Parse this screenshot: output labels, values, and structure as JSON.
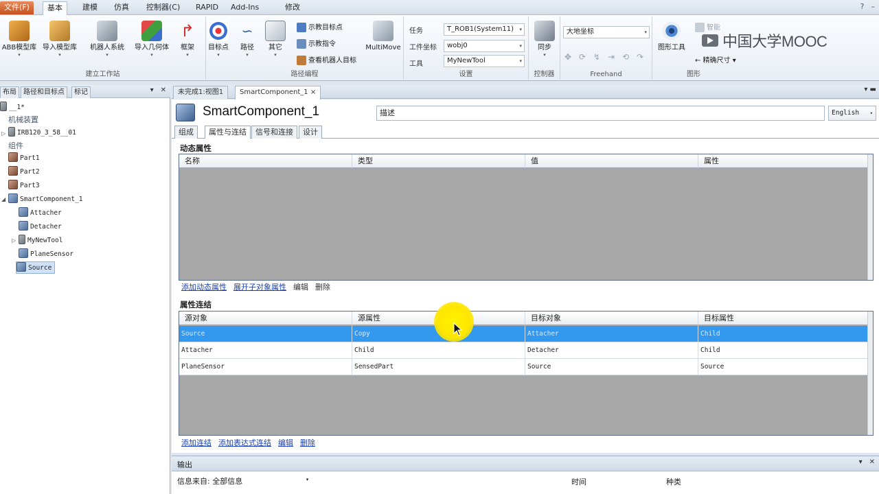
{
  "ribbon_tabs": [
    "文件(F)",
    "基本",
    "建模",
    "仿真",
    "控制器(C)",
    "RAPID",
    "Add-Ins",
    "修改"
  ],
  "groups": {
    "build_station": {
      "label": "建立工作站",
      "buttons": [
        "ABB模型库",
        "导入模型库",
        "机器人系统",
        "导入几何体",
        "框架"
      ]
    },
    "path_programming": {
      "label": "路径编程",
      "big_buttons": [
        "目标点",
        "路径",
        "其它"
      ],
      "small_buttons": [
        "示教目标点",
        "示教指令",
        "查看机器人目标"
      ],
      "multimove": "MultiMove"
    },
    "settings": {
      "label": "设置",
      "task_label": "任务",
      "task_value": "T_ROB1(System11)",
      "wobj_label": "工件坐标",
      "wobj_value": "wobj0",
      "tool_label": "工具",
      "tool_value": "MyNewTool"
    },
    "controller": {
      "label": "控制器",
      "sync": "同步"
    },
    "freehand": {
      "label": "Freehand",
      "coord_value": "大地坐标"
    },
    "graphics": {
      "label": "图形",
      "view_tool": "图形工具",
      "measure_small": "智能",
      "dimension": "← 精确尺寸 ▾"
    }
  },
  "watermark": {
    "text": "中国大学MOOC"
  },
  "left_panel": {
    "tabs": [
      "布局",
      "路径和目标点",
      "标记"
    ],
    "station": "__1*",
    "cat_mechanisms": "机械装置",
    "robot": "IRB120_3_58__01",
    "cat_components": "组件",
    "parts": [
      "Part1",
      "Part2",
      "Part3"
    ],
    "smart_component": "SmartComponent_1",
    "children": [
      "Attacher",
      "Detacher",
      "MyNewTool",
      "PlaneSensor",
      "Source"
    ]
  },
  "doc_tabs": [
    "未完成1:视图1",
    "SmartComponent_1 ×"
  ],
  "component": {
    "title": "SmartComponent_1",
    "description": "描述",
    "language": "English"
  },
  "sub_tabs": [
    "组成",
    "属性与连结",
    "信号和连接",
    "设计"
  ],
  "dynamic_props": {
    "title": "动态属性",
    "columns": [
      "名称",
      "类型",
      "值",
      "属性"
    ],
    "links": [
      "添加动态属性",
      "展开子对象属性"
    ],
    "texts": [
      "编辑",
      "删除"
    ]
  },
  "prop_links": {
    "title": "属性连结",
    "columns": [
      "源对象",
      "源属性",
      "目标对象",
      "目标属性"
    ],
    "rows": [
      [
        "Source",
        "Copy",
        "Attacher",
        "Child"
      ],
      [
        "Attacher",
        "Child",
        "Detacher",
        "Child"
      ],
      [
        "PlaneSensor",
        "SensedPart",
        "Source",
        "Source"
      ]
    ],
    "links": [
      "添加连结",
      "添加表达式连结",
      "编辑",
      "删除"
    ]
  },
  "output": {
    "title": "输出",
    "filter_label": "信息来自:",
    "filter_value": "全部信息",
    "col_time": "时间",
    "col_kind": "种类"
  },
  "colors": {
    "selection": "#3399ee",
    "link": "#1a3fb5",
    "grid_bg": "#a8a8a8",
    "file_tab": "#d0622e"
  }
}
